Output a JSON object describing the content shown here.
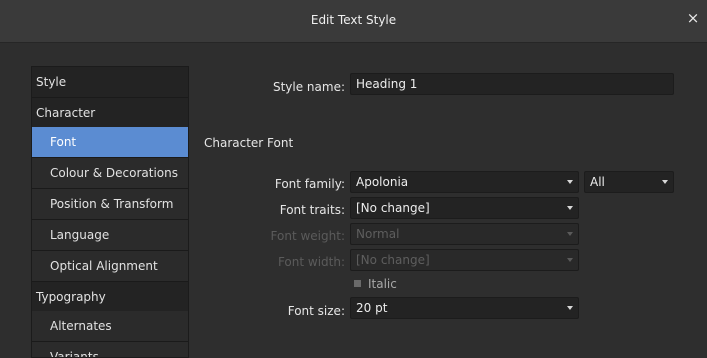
{
  "window": {
    "title": "Edit Text Style",
    "close_glyph": "×"
  },
  "sidebar": {
    "items": [
      {
        "label": "Style",
        "level": 1,
        "selected": false
      },
      {
        "label": "Character",
        "level": 1,
        "selected": false
      },
      {
        "label": "Font",
        "level": 2,
        "selected": true
      },
      {
        "label": "Colour & Decorations",
        "level": 2,
        "selected": false
      },
      {
        "label": "Position & Transform",
        "level": 2,
        "selected": false
      },
      {
        "label": "Language",
        "level": 2,
        "selected": false
      },
      {
        "label": "Optical Alignment",
        "level": 2,
        "selected": false
      },
      {
        "label": "Typography",
        "level": 1,
        "selected": false
      },
      {
        "label": "Alternates",
        "level": 2,
        "selected": false
      },
      {
        "label": "Variants",
        "level": 2,
        "selected": false
      }
    ]
  },
  "form": {
    "style_name_label": "Style name:",
    "style_name_value": "Heading 1",
    "section_title": "Character Font",
    "font_family_label": "Font family:",
    "font_family_value": "Apolonia",
    "font_filter_value": "All",
    "font_traits_label": "Font traits:",
    "font_traits_value": "[No change]",
    "font_weight_label": "Font weight:",
    "font_weight_value": "Normal",
    "font_width_label": "Font width:",
    "font_width_value": "[No change]",
    "italic_label": "Italic",
    "font_size_label": "Font size:",
    "font_size_value": "20 pt"
  },
  "colors": {
    "selection": "#5b8cd2",
    "background": "#2e2e2e",
    "field": "#232323"
  }
}
